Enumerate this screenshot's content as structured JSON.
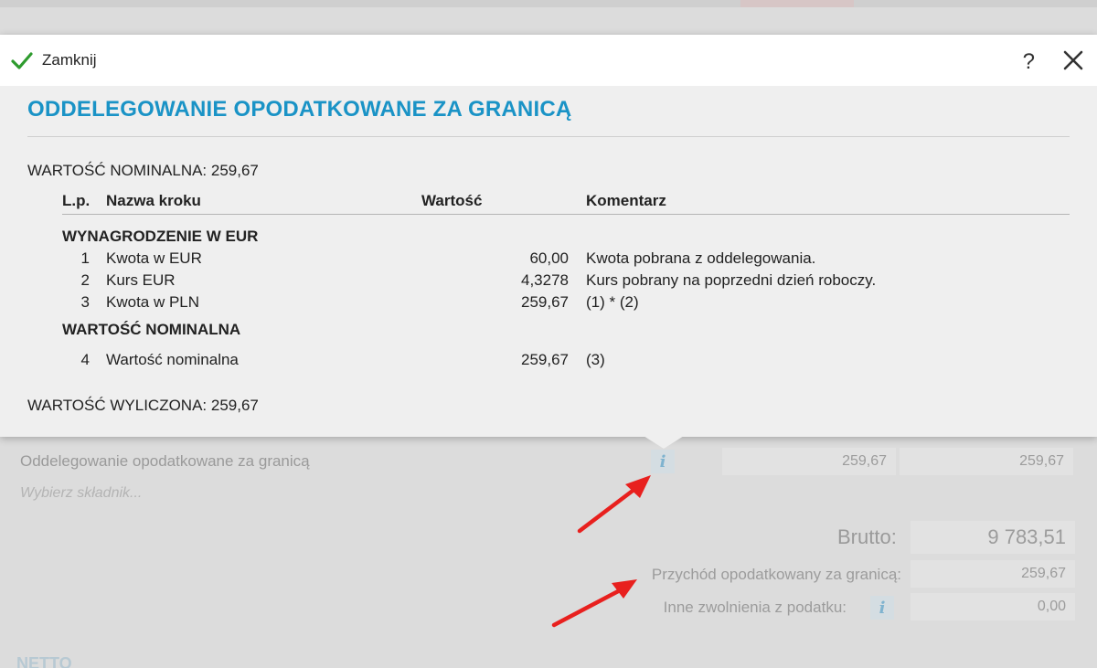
{
  "modal": {
    "close_label": "Zamknij",
    "help_glyph": "?",
    "title": "ODDELEGOWANIE OPODATKOWANE ZA GRANICĄ",
    "nominal_summary": "WARTOŚĆ NOMINALNA:  259,67",
    "computed_summary": "WARTOŚĆ WYLICZONA:  259,67",
    "table": {
      "headers": {
        "lp": "L.p.",
        "name": "Nazwa kroku",
        "value": "Wartość",
        "comment": "Komentarz"
      },
      "sections": [
        {
          "title": "WYNAGRODZENIE W EUR",
          "rows": [
            {
              "lp": "1",
              "name": "Kwota w EUR",
              "value": "60,00",
              "comment": "Kwota pobrana z oddelegowania."
            },
            {
              "lp": "2",
              "name": "Kurs EUR",
              "value": "4,3278",
              "comment": "Kurs pobrany na poprzedni dzień roboczy."
            },
            {
              "lp": "3",
              "name": "Kwota w PLN",
              "value": "259,67",
              "comment": "(1) * (2)"
            }
          ]
        },
        {
          "title": "WARTOŚĆ NOMINALNA",
          "rows": [
            {
              "lp": "4",
              "name": "Wartość nominalna",
              "value": "259,67",
              "comment": "(3)"
            }
          ]
        }
      ]
    }
  },
  "background": {
    "component_row": {
      "name": "Oddelegowanie opodatkowane za granicą",
      "value1": "259,67",
      "value2": "259,67"
    },
    "select_placeholder": "Wybierz składnik...",
    "brutto_label": "Brutto:",
    "brutto_value": "9 783,51",
    "foreign_income_label": "Przychód opodatkowany za granicą:",
    "foreign_income_value": "259,67",
    "other_exemptions_label": "Inne zwolnienia z podatku:",
    "other_exemptions_value": "0,00",
    "netto_label": "NETTO",
    "info_glyph": "i"
  },
  "colors": {
    "title": "#1a93c6",
    "check": "#2e9b2e",
    "arrow": "#e8201e"
  }
}
